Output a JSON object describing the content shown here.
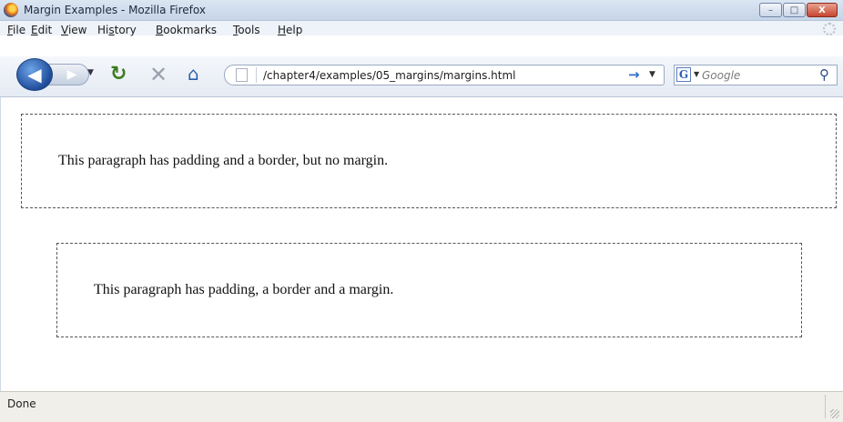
{
  "window": {
    "title": "Margin Examples - Mozilla Firefox",
    "buttons": {
      "minimize": "–",
      "maximize": "□",
      "close": "X"
    }
  },
  "menu": [
    {
      "label": "File",
      "key": "F",
      "rest": "ile"
    },
    {
      "label": "Edit",
      "key": "E",
      "rest": "dit"
    },
    {
      "label": "View",
      "key": "V",
      "rest": "iew"
    },
    {
      "label": "History",
      "pre": "Hi",
      "key": "s",
      "rest": "tory"
    },
    {
      "label": "Bookmarks",
      "key": "B",
      "rest": "ookmarks"
    },
    {
      "label": "Tools",
      "key": "T",
      "rest": "ools"
    },
    {
      "label": "Help",
      "key": "H",
      "rest": "elp"
    }
  ],
  "toolbar": {
    "back_icon": "back-arrow-icon",
    "forward_icon": "forward-arrow-icon",
    "reload_icon": "reload-icon",
    "stop_icon": "stop-icon",
    "home_icon": "home-icon"
  },
  "address": {
    "url": "/chapter4/examples/05_margins/margins.html"
  },
  "search": {
    "engine_letter": "G",
    "placeholder": "Google"
  },
  "page": {
    "paragraph_1": "This paragraph has padding and a border, but no margin.",
    "paragraph_2": "This paragraph has padding, a border and a margin."
  },
  "status": {
    "text": "Done"
  }
}
